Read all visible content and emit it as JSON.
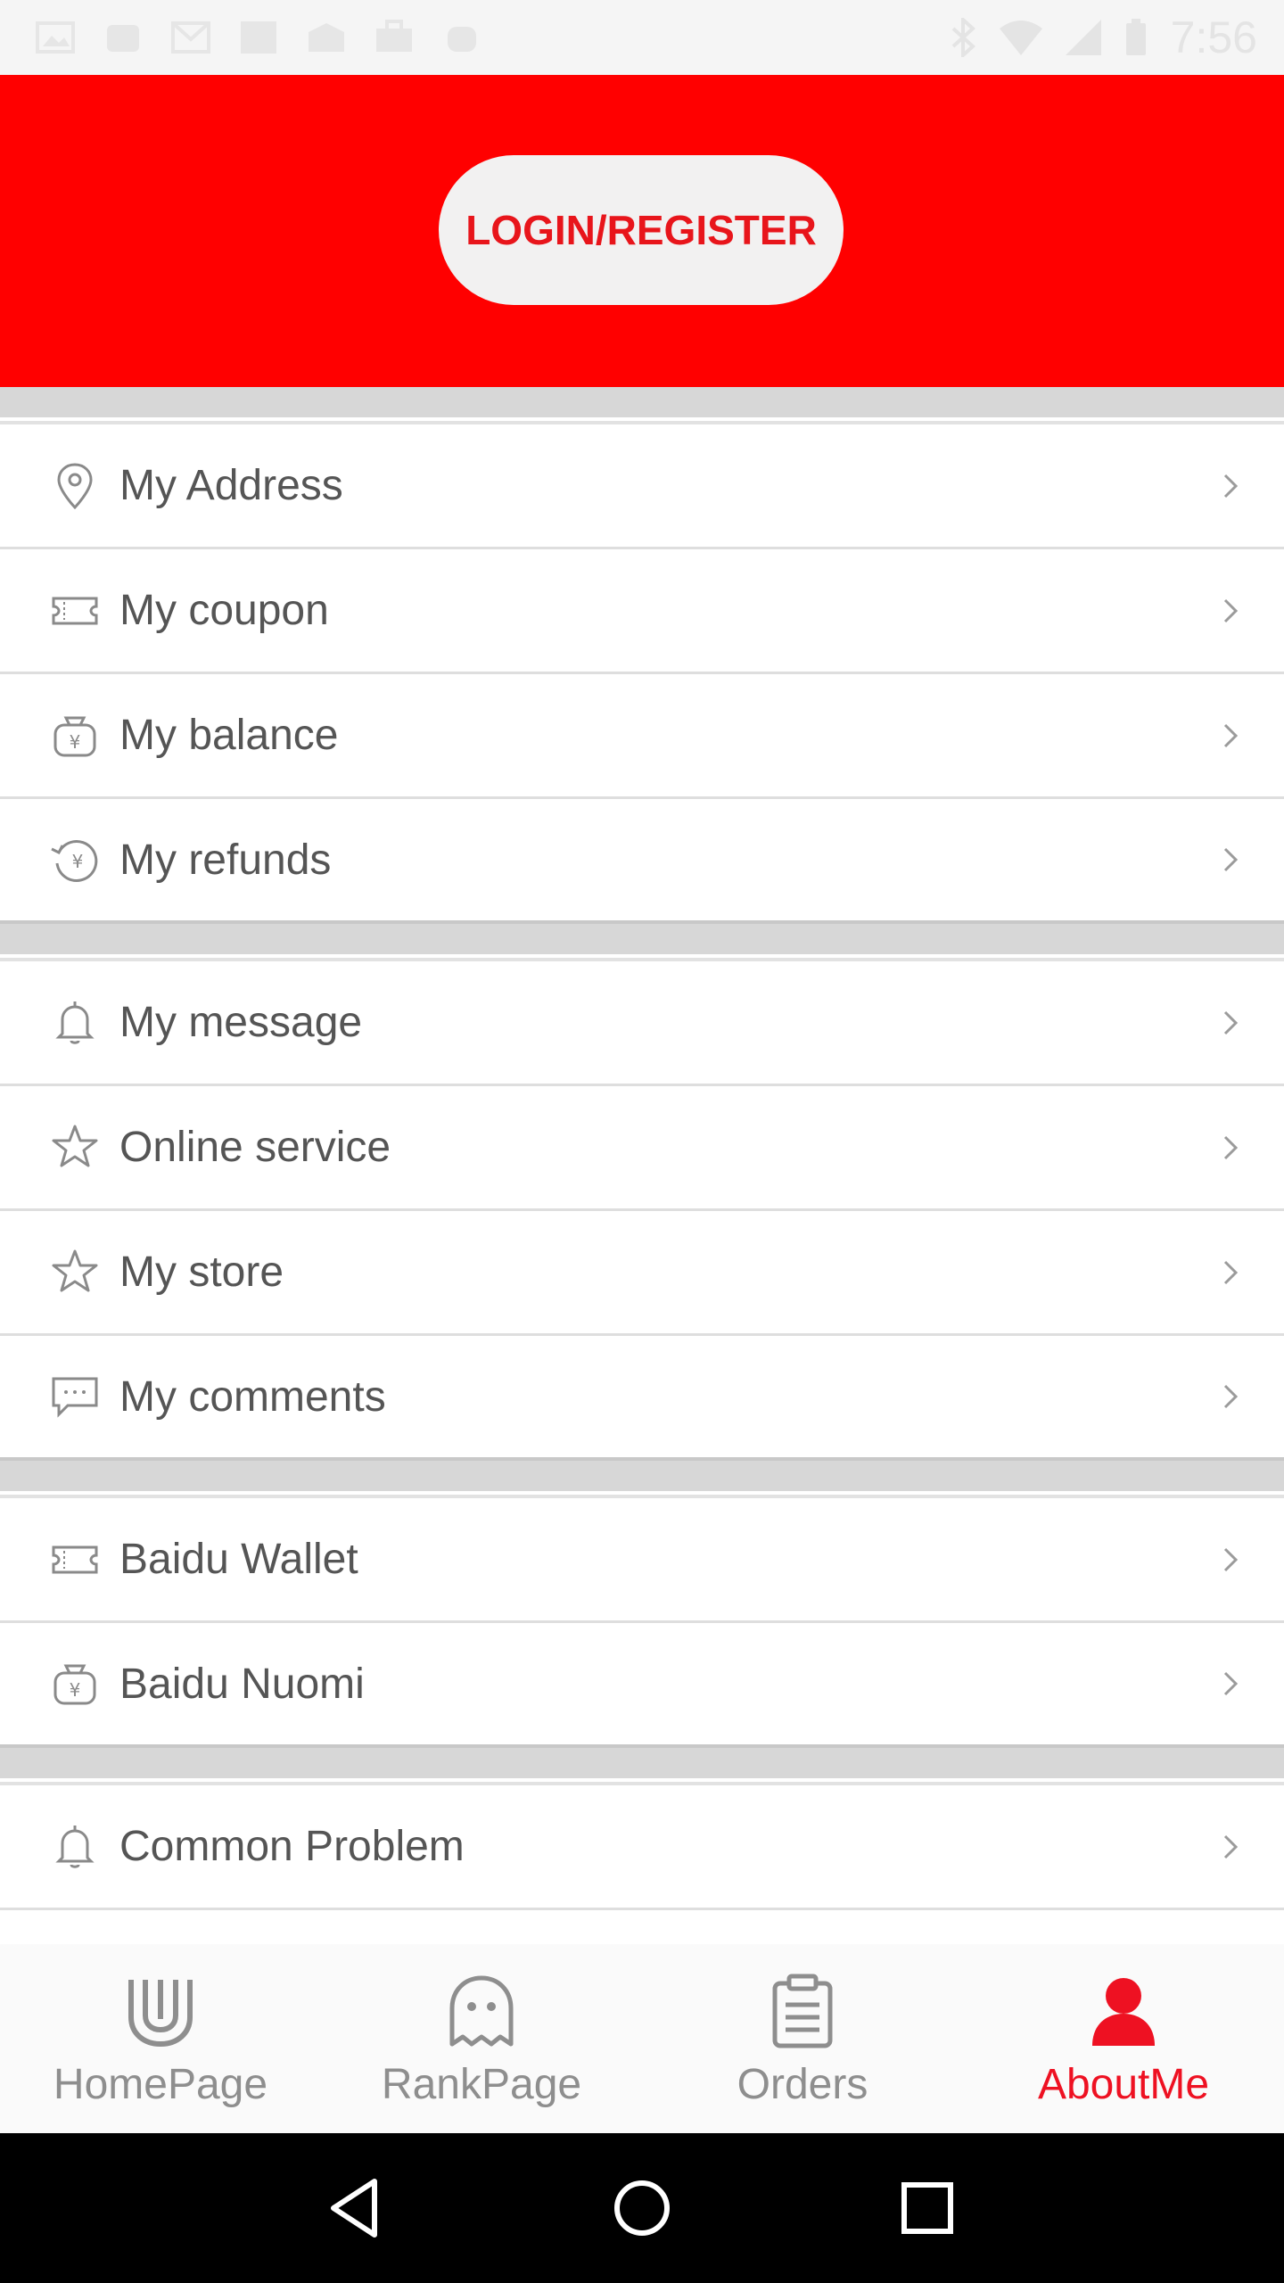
{
  "status_bar": {
    "time": "7:56"
  },
  "header": {
    "login_label": "LOGIN/REGISTER",
    "bg_color": "#ff0000",
    "button_text_color": "#e8151b"
  },
  "menu": {
    "group1": [
      {
        "label": "My Address",
        "icon": "location-pin-icon"
      },
      {
        "label": "My coupon",
        "icon": "ticket-icon"
      },
      {
        "label": "My balance",
        "icon": "money-bag-icon"
      },
      {
        "label": "My refunds",
        "icon": "refund-icon"
      }
    ],
    "group2": [
      {
        "label": "My message",
        "icon": "bell-icon"
      },
      {
        "label": "Online service",
        "icon": "star-icon"
      },
      {
        "label": "My store",
        "icon": "star-icon"
      },
      {
        "label": "My comments",
        "icon": "comment-icon"
      }
    ],
    "group3": [
      {
        "label": "Baidu Wallet",
        "icon": "ticket-icon"
      },
      {
        "label": "Baidu Nuomi",
        "icon": "money-bag-icon"
      }
    ],
    "group4": [
      {
        "label": "Common Problem",
        "icon": "bell-icon"
      }
    ]
  },
  "tabbar": {
    "tabs": [
      {
        "label": "HomePage",
        "icon": "home-u-icon"
      },
      {
        "label": "RankPage",
        "icon": "ghost-icon"
      },
      {
        "label": "Orders",
        "icon": "clipboard-icon"
      },
      {
        "label": "AboutMe",
        "icon": "person-icon",
        "active": true
      }
    ],
    "active_color": "#ee1122"
  }
}
